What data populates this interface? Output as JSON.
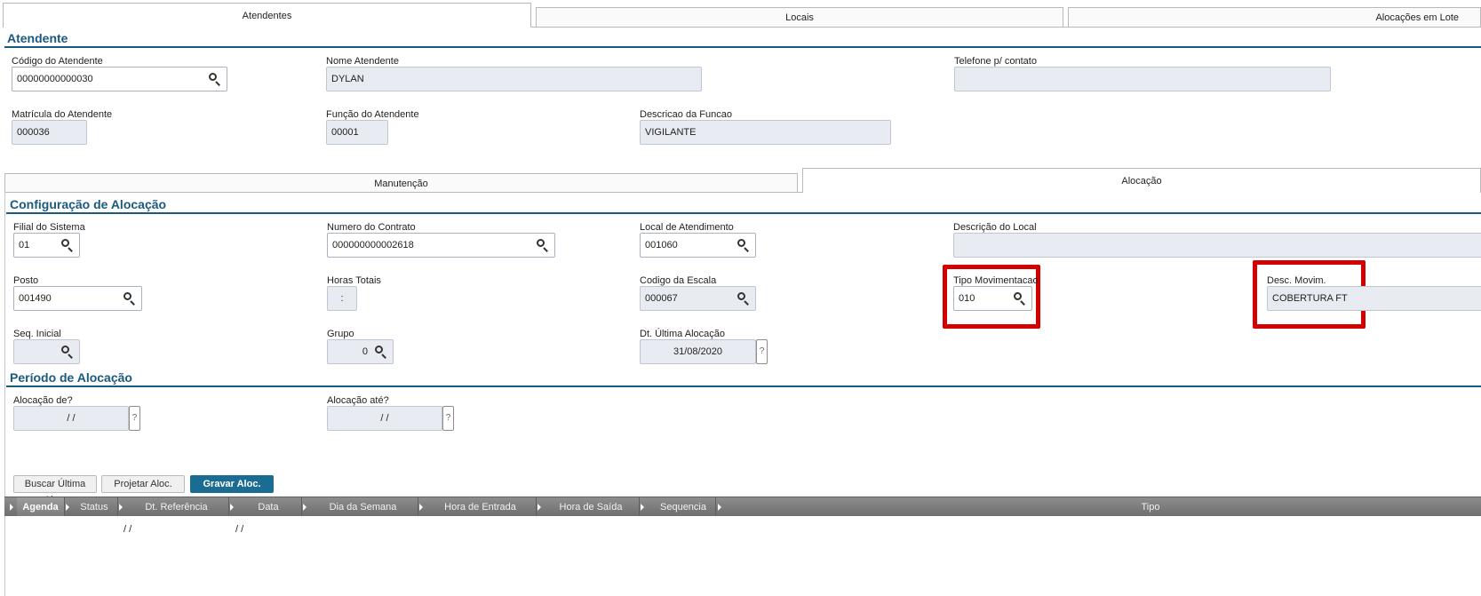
{
  "top_tabs": {
    "attendants": "Atendentes",
    "locations": "Locais",
    "batch": "Alocações em Lote"
  },
  "attendant_section": {
    "title": "Atendente",
    "code_label": "Código do Atendente",
    "code_value": "00000000000030",
    "name_label": "Nome Atendente",
    "name_value": "DYLAN",
    "phone_label": "Telefone p/ contato",
    "phone_value": "",
    "registration_label": "Matrícula do Atendente",
    "registration_value": "000036",
    "function_label": "Função do Atendente",
    "function_value": "00001",
    "function_desc_label": "Descricao da Funcao",
    "function_desc_value": "VIGILANTE"
  },
  "inner_tabs": {
    "maintenance": "Manutenção",
    "allocation": "Alocação"
  },
  "config_section": {
    "title": "Configuração de Alocação",
    "branch_label": "Filial do Sistema",
    "branch_value": "01",
    "contract_label": "Numero do Contrato",
    "contract_value": "000000000002618",
    "service_location_label": "Local de Atendimento",
    "service_location_value": "001060",
    "location_desc_label": "Descrição do Local",
    "location_desc_value": "",
    "post_label": "Posto",
    "post_value": "001490",
    "total_hours_label": "Horas Totais",
    "total_hours_value": ":",
    "scale_code_label": "Codigo da Escala",
    "scale_code_value": "000067",
    "movement_type_label": "Tipo Movimentacao",
    "movement_type_value": "010",
    "movement_desc_label": "Desc. Movim.",
    "movement_desc_value": "COBERTURA FT",
    "initial_seq_label": "Seq. Inicial",
    "initial_seq_value": "",
    "group_label": "Grupo",
    "group_value": "0",
    "last_alloc_label": "Dt. Última Alocação",
    "last_alloc_value": "31/08/2020",
    "help_glyph": "?"
  },
  "period_section": {
    "title": "Período de Alocação",
    "from_label": "Alocação de?",
    "from_value": "/ /",
    "to_label": "Alocação até?",
    "to_value": "/ /"
  },
  "buttons": {
    "fetch_last": "Buscar Última Aloc.",
    "project": "Projetar Aloc.",
    "save": "Gravar Aloc."
  },
  "grid": {
    "columns": [
      "Agenda",
      "Status",
      "Dt. Referência",
      "Data",
      "Dia da Semana",
      "Hora de Entrada",
      "Hora de Saída",
      "Sequencia",
      "Tipo"
    ],
    "row": {
      "ref_date": "/ /",
      "date": "/ /"
    }
  },
  "colors": {
    "accent": "#1a5a7e",
    "highlight": "#d40000",
    "primary_button": "#1b6c93"
  },
  "icons": [
    "search-icon",
    "help-icon",
    "sort-arrow-icon"
  ]
}
